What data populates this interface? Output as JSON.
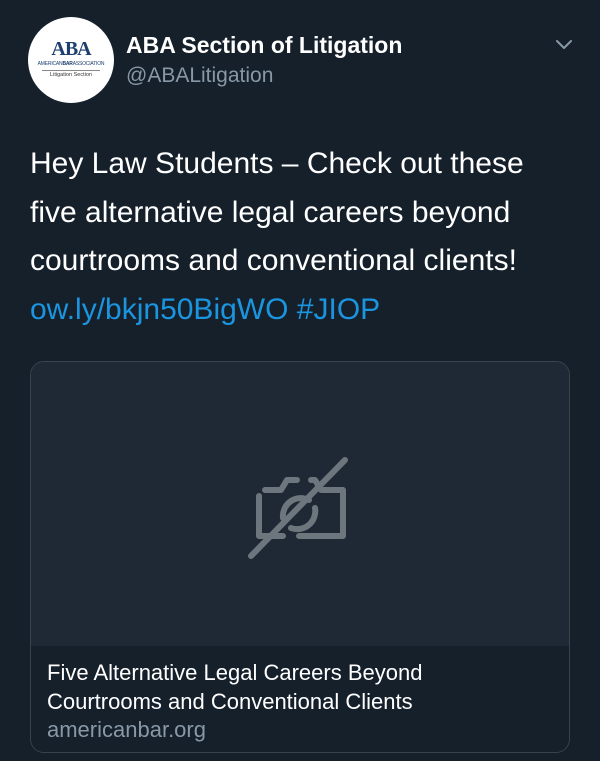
{
  "author": {
    "display_name": "ABA Section of Litigation",
    "handle": "@ABALitigation",
    "avatar": {
      "logo_mark": "ABA",
      "org_text_1": "AMERICAN",
      "org_text_2": "BAR",
      "org_text_3": "ASSOCIATION",
      "section_text": "Litigation Section"
    }
  },
  "tweet": {
    "lines": [
      "Hey Law Students – Check out these",
      "five alternative legal careers beyond",
      "courtrooms and conventional clients!"
    ],
    "link_text": "ow.ly/bkjn50BigWO",
    "hashtag": "#JIOP"
  },
  "card": {
    "image_icon": "image-unavailable-icon",
    "title_line_1": "Five Alternative Legal Careers Beyond",
    "title_line_2": "Courtrooms and Conventional Clients",
    "domain": "americanbar.org"
  },
  "menu_icon": "chevron-down-icon",
  "colors": {
    "background": "#15202b",
    "link": "#1b95e0",
    "secondary_text": "#8899a6",
    "card_border": "#38444d",
    "card_image_bg": "#1e2935"
  }
}
